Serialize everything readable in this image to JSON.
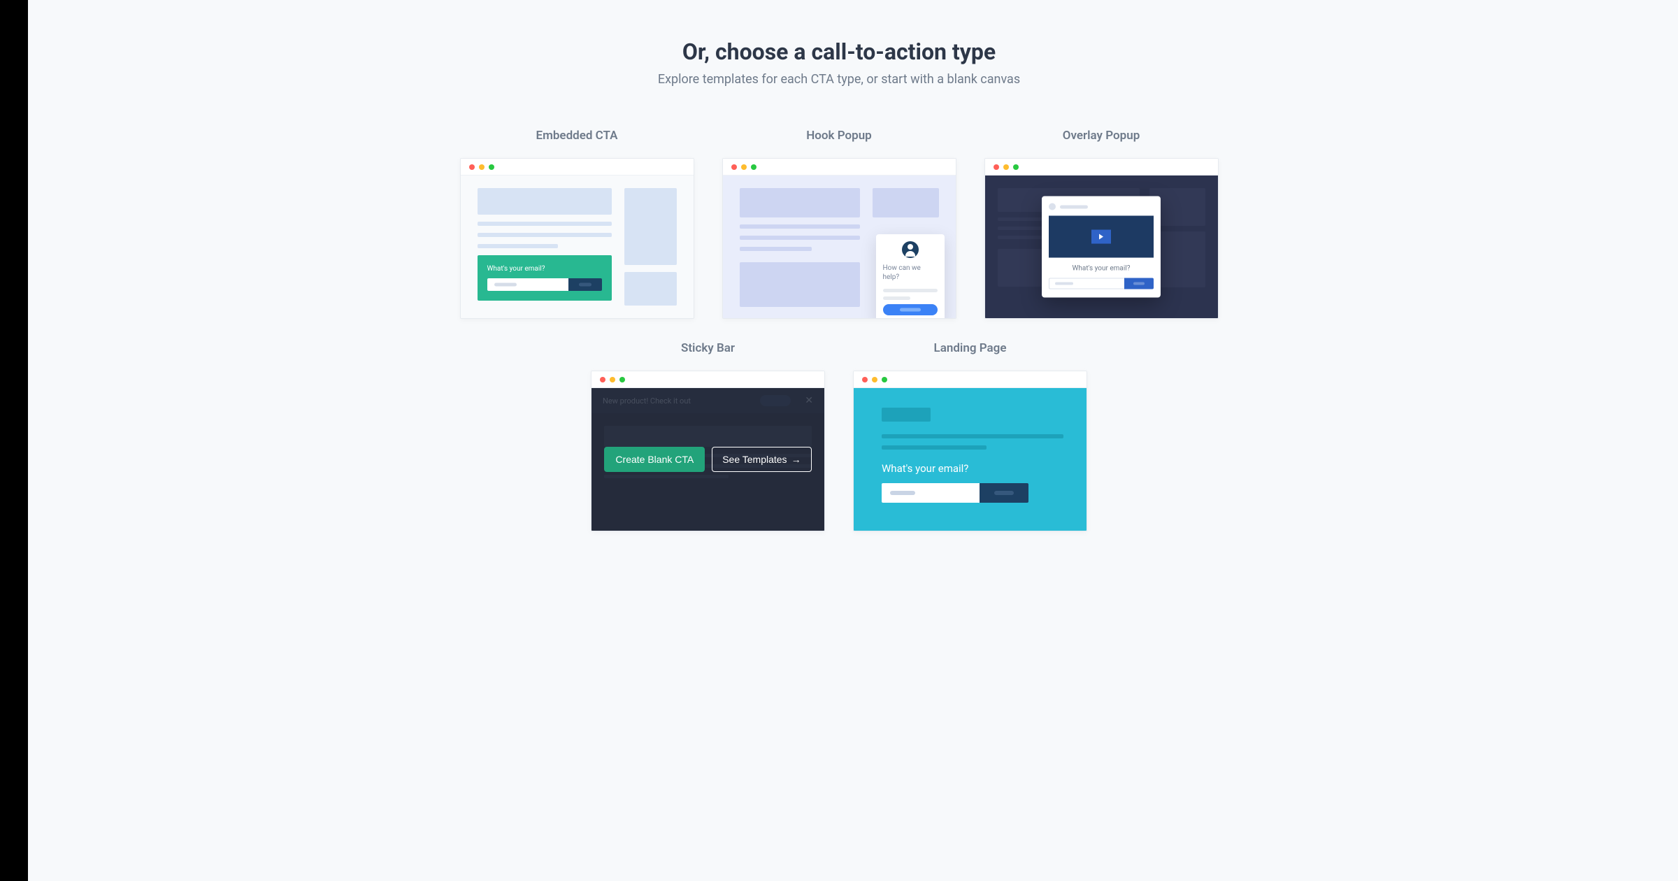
{
  "header": {
    "title": "Or, choose a call-to-action type",
    "subtitle": "Explore templates for each CTA type, or start with a blank canvas"
  },
  "cards": {
    "embedded": {
      "title": "Embedded CTA",
      "email_label": "What's your email?"
    },
    "hook": {
      "title": "Hook Popup",
      "help_text": "How can we help?"
    },
    "overlay": {
      "title": "Overlay Popup",
      "email_label": "What's your email?"
    },
    "sticky": {
      "title": "Sticky Bar",
      "banner_text": "New product!  Check it out",
      "close_glyph": "✕",
      "create_label": "Create Blank CTA",
      "templates_label": "See Templates",
      "arrow_glyph": "→"
    },
    "landing": {
      "title": "Landing Page",
      "email_label": "What's your email?"
    }
  }
}
